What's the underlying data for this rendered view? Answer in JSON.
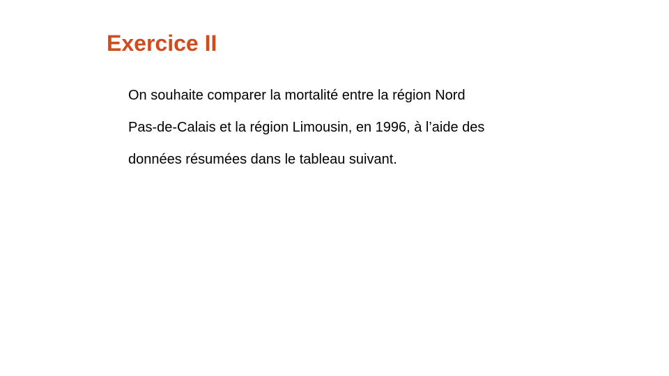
{
  "slide": {
    "title": "Exercice II",
    "title_color": "#d24b1d",
    "body_lines": [
      "On souhaite comparer la mortalité entre la région Nord",
      "Pas-de-Calais et la région Limousin, en 1996, à l’aide des",
      "données résumées dans le tableau suivant."
    ]
  }
}
